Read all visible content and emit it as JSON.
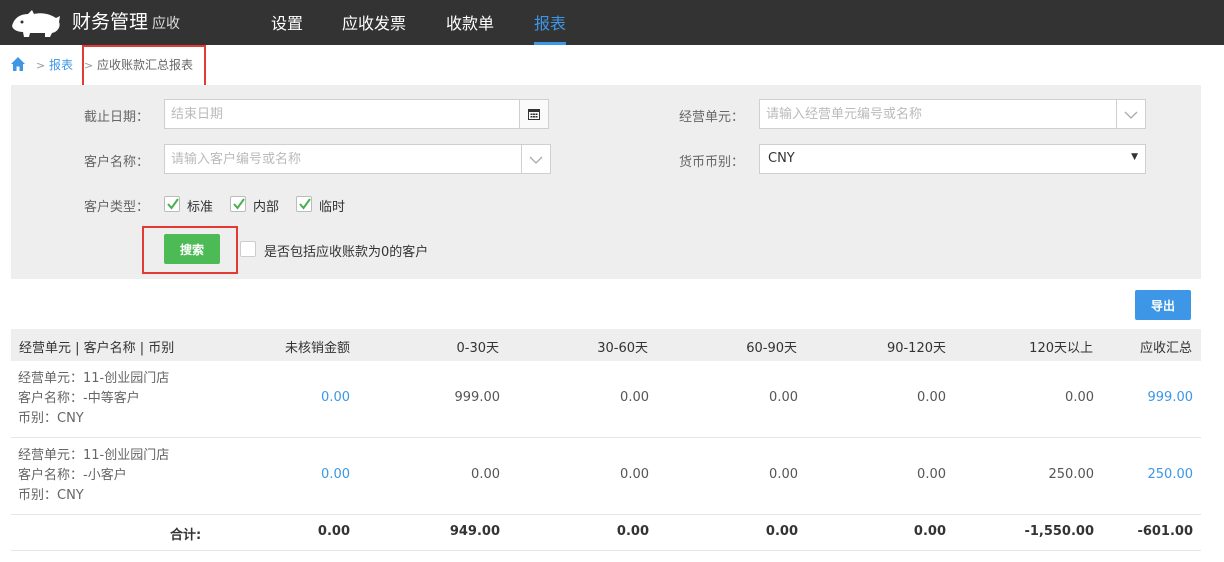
{
  "app": {
    "brand": "财务管理",
    "brand_sub": "应收",
    "nav": [
      "设置",
      "应收发票",
      "收款单",
      "报表"
    ],
    "active_nav": 3
  },
  "breadcrumb": {
    "parent": "报表",
    "current": "应收账款汇总报表",
    "sep": ">"
  },
  "filters": {
    "cutoff_label": "截止日期：",
    "cutoff_placeholder": "结束日期",
    "unit_label": "经营单元：",
    "unit_placeholder": "请输入经营单元编号或名称",
    "customer_label": "客户名称：",
    "customer_placeholder": "请输入客户编号或名称",
    "currency_label": "货币币别：",
    "currency_value": "CNY",
    "type_label": "客户类型：",
    "types": [
      {
        "label": "标准",
        "checked": true
      },
      {
        "label": "内部",
        "checked": true
      },
      {
        "label": "临时",
        "checked": true
      }
    ],
    "search_label": "搜索",
    "include_zero_label": "是否包括应收账款为0的客户",
    "include_zero_checked": false
  },
  "export_label": "导出",
  "table": {
    "headers": [
      "经营单元 | 客户名称 | 币别",
      "未核销金额",
      "0-30天",
      "30-60天",
      "60-90天",
      "90-120天",
      "120天以上",
      "应收汇总"
    ],
    "rows": [
      {
        "unit": "经营单元：11-创业园门店",
        "customer": "客户名称：-中等客户",
        "currency": "币别：CNY",
        "values": [
          "0.00",
          "999.00",
          "0.00",
          "0.00",
          "0.00",
          "0.00",
          "999.00"
        ]
      },
      {
        "unit": "经营单元：11-创业园门店",
        "customer": "客户名称：-小客户",
        "currency": "币别：CNY",
        "values": [
          "0.00",
          "0.00",
          "0.00",
          "0.00",
          "0.00",
          "250.00",
          "250.00"
        ]
      }
    ],
    "total_label": "合计:",
    "totals": [
      "0.00",
      "949.00",
      "0.00",
      "0.00",
      "0.00",
      "-1,550.00",
      "-601.00"
    ]
  },
  "colors": {
    "topbar": "#333333",
    "accent": "#3d96e6",
    "search_button": "#4cba55",
    "highlight_box": "#e53935"
  }
}
